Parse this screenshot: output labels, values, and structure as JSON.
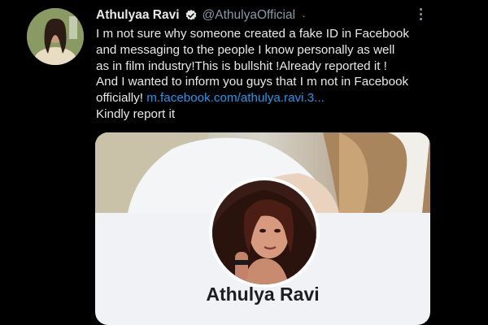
{
  "tweet": {
    "author_name": "Athulyaa Ravi",
    "handle": "@AthulyaOfficial",
    "separator": "·",
    "lines": [
      "I m not sure why someone created a fake ID in Facebook",
      "and messaging to the people I know personally as well",
      "as in film industry!This is bullshit !Already reported it !",
      "And I wanted to inform you guys that I m not in Facebook"
    ],
    "last_line_prefix": "officially! ",
    "link_text": "m.facebook.com/athulya.ravi.3...",
    "closing_line": "Kindly report it",
    "icons": {
      "verified": "verified-badge-icon",
      "more": "more-options-icon"
    }
  },
  "card": {
    "profile_name": "Athulya Ravi"
  },
  "colors": {
    "background": "#000000",
    "text": "#e7e9ea",
    "muted": "#8b98a5",
    "link": "#1d9bf0",
    "card_bg": "#f0f2f5"
  }
}
